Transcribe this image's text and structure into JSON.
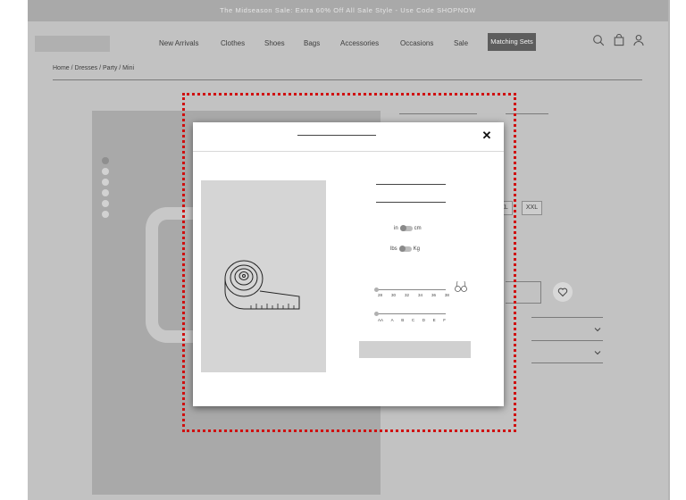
{
  "promo_banner": "The Midseason Sale: Extra 60% Off All Sale Style - Use Code SHOPNOW",
  "nav": {
    "items": [
      "New Arrivals",
      "Clothes",
      "Shoes",
      "Bags",
      "Accessories",
      "Occasions",
      "Sale"
    ],
    "cta": "Matching Sets"
  },
  "header_icons": [
    "search-icon",
    "bag-icon",
    "user-icon"
  ],
  "breadcrumb": "Home / Dresses / Party / Mini",
  "sizes": [
    "XL",
    "XXL"
  ],
  "modal": {
    "units_length": {
      "left": "in",
      "right": "cm"
    },
    "units_weight": {
      "left": "lbs",
      "right": "Kg"
    },
    "band_sizes": [
      "28",
      "30",
      "32",
      "34",
      "36",
      "38"
    ],
    "cup_sizes": [
      "AA",
      "A",
      "B",
      "C",
      "D",
      "E",
      "F"
    ],
    "close_icon": "close-icon"
  },
  "colors": {
    "accent_dark": "#5d5d5d",
    "highlight": "#d01010"
  }
}
